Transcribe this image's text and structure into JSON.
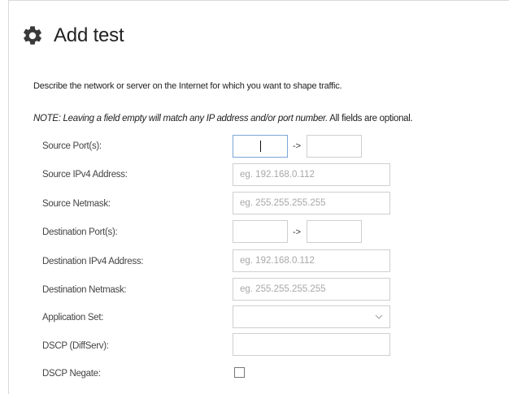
{
  "header": {
    "title": "Add test",
    "icon": "gear-icon"
  },
  "intro": {
    "description": "Describe the network or server on the Internet for which you want to shape traffic.",
    "note_italic": "NOTE: Leaving a field empty will match any IP address and/or port number.",
    "note_rest": " All fields are optional."
  },
  "form": {
    "source_port": {
      "label": "Source Port(s):",
      "from_value": "",
      "to_value": "",
      "arrow": "->"
    },
    "source_ip": {
      "label": "Source IPv4 Address:",
      "placeholder": "eg. 192.168.0.112",
      "value": ""
    },
    "source_netmask": {
      "label": "Source Netmask:",
      "placeholder": "eg. 255.255.255.255",
      "value": ""
    },
    "dest_port": {
      "label": "Destination Port(s):",
      "from_value": "",
      "to_value": "",
      "arrow": "->"
    },
    "dest_ip": {
      "label": "Destination IPv4 Address:",
      "placeholder": "eg. 192.168.0.112",
      "value": ""
    },
    "dest_netmask": {
      "label": "Destination Netmask:",
      "placeholder": "eg. 255.255.255.255",
      "value": ""
    },
    "app_set": {
      "label": "Application Set:",
      "selected": ""
    },
    "dscp": {
      "label": "DSCP (DiffServ):",
      "value": ""
    },
    "dscp_negate": {
      "label": "DSCP Negate:",
      "checked": false
    }
  }
}
